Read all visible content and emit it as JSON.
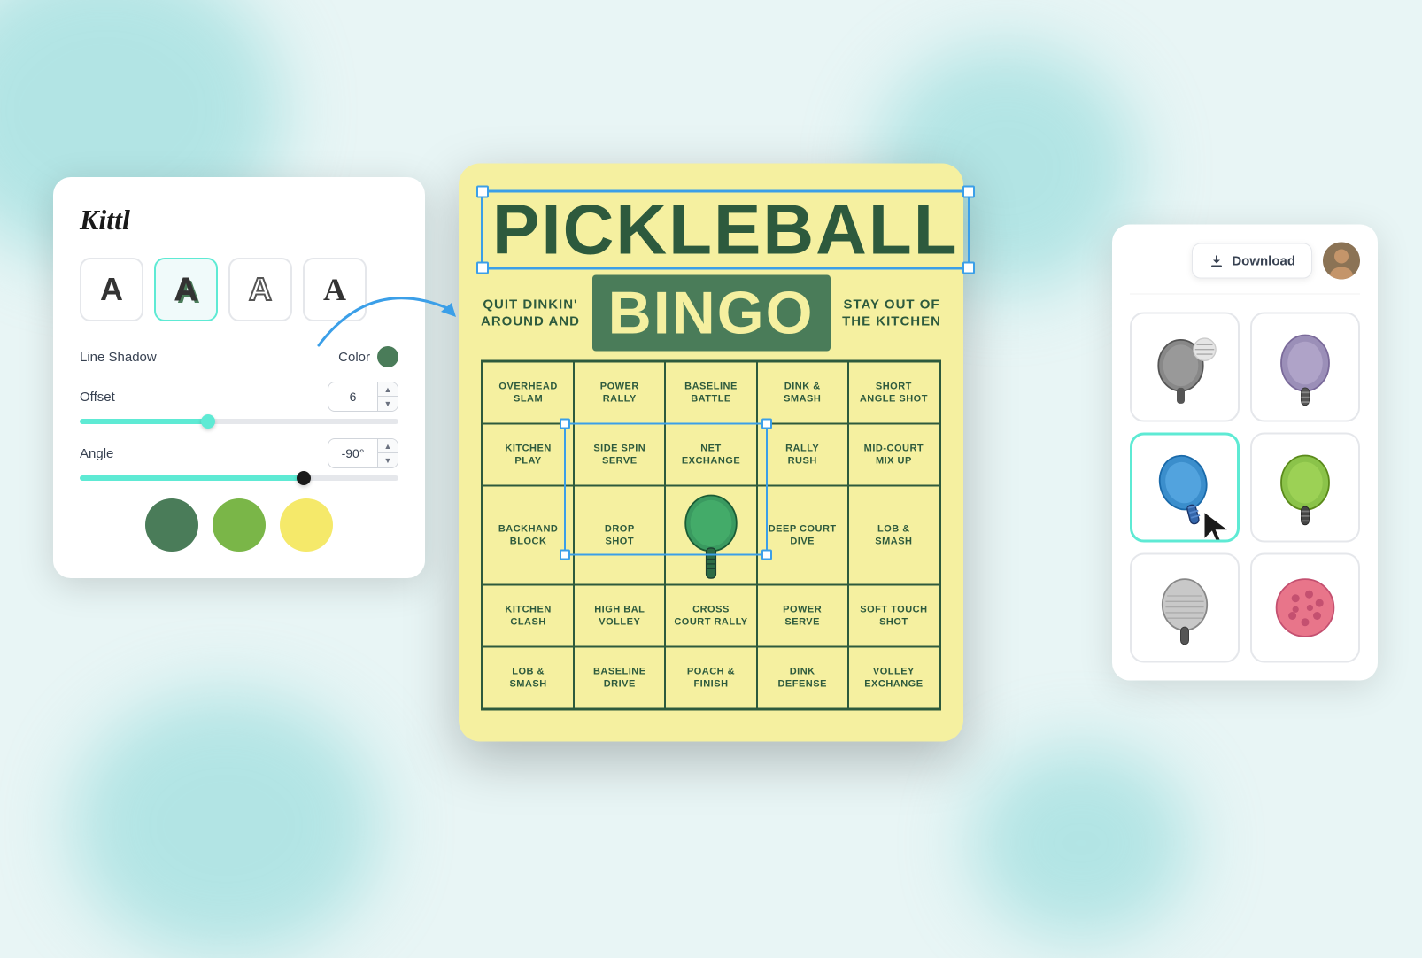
{
  "brand": {
    "name": "Kittl"
  },
  "header": {
    "download_label": "Download"
  },
  "left_panel": {
    "text_style_buttons": [
      {
        "id": "plain",
        "label": "A",
        "style": "plain"
      },
      {
        "id": "shadow",
        "label": "A",
        "style": "active shadow"
      },
      {
        "id": "outline",
        "label": "A",
        "style": "outline"
      },
      {
        "id": "serif",
        "label": "A",
        "style": "serif"
      }
    ],
    "line_shadow_label": "Line Shadow",
    "color_label": "Color",
    "offset_label": "Offset",
    "offset_value": "6",
    "angle_label": "Angle",
    "angle_value": "-90°",
    "swatches": [
      {
        "color": "#4a7c59",
        "label": "dark green"
      },
      {
        "color": "#7ab648",
        "label": "light green"
      },
      {
        "color": "#f5e96a",
        "label": "yellow"
      }
    ]
  },
  "bingo_card": {
    "title": "PICKLEBALL",
    "subtitle": "BINGO",
    "left_tagline": "QUIT DINKIN'\nAROUND AND",
    "right_tagline": "STAY OUT OF\nTHE KITCHEN",
    "cells": [
      "OVERHEAD\nSLAM",
      "POWER\nRALLY",
      "BASELINE\nBATTLE",
      "DINK &\nSMASH",
      "SHORT\nANGLE SHOT",
      "KITCHEN\nPLAY",
      "SIDE SPIN\nSERVE",
      "NET\nEXCHANGE",
      "RALLY\nRUSH",
      "MID-COURT\nMIX UP",
      "BACKHAND\nBLOCK",
      "DROP\nSHOT",
      "CENTER",
      "DEEP COURT\nDIVE",
      "LOB &\nSMASH",
      "KITCHEN\nCLASH",
      "HIGH BAL\nVOLLEY",
      "CROSS\nCOURT RALLY",
      "POWER\nSERVE",
      "SOFT TOUCH\nSHOT",
      "LOB &\nSMASH",
      "BASELINE\nDRIVE",
      "POACH &\nFINISH",
      "DINK\nDEFENSE",
      "VOLLEY\nEXCHANGE"
    ]
  },
  "right_panel": {
    "stickers": [
      {
        "id": "paddle-ball",
        "label": "paddle with ball"
      },
      {
        "id": "paddle-purple",
        "label": "purple paddle"
      },
      {
        "id": "paddle-blue",
        "label": "blue paddle selected"
      },
      {
        "id": "paddle-green",
        "label": "green paddle"
      },
      {
        "id": "paddle-gray",
        "label": "gray paddle"
      },
      {
        "id": "ball-pink",
        "label": "pink ball"
      }
    ]
  },
  "colors": {
    "teal_accent": "#5eead4",
    "dark_green": "#2d5a3d",
    "card_bg": "#f5f0a0",
    "blue_selection": "#3b9fe8"
  }
}
